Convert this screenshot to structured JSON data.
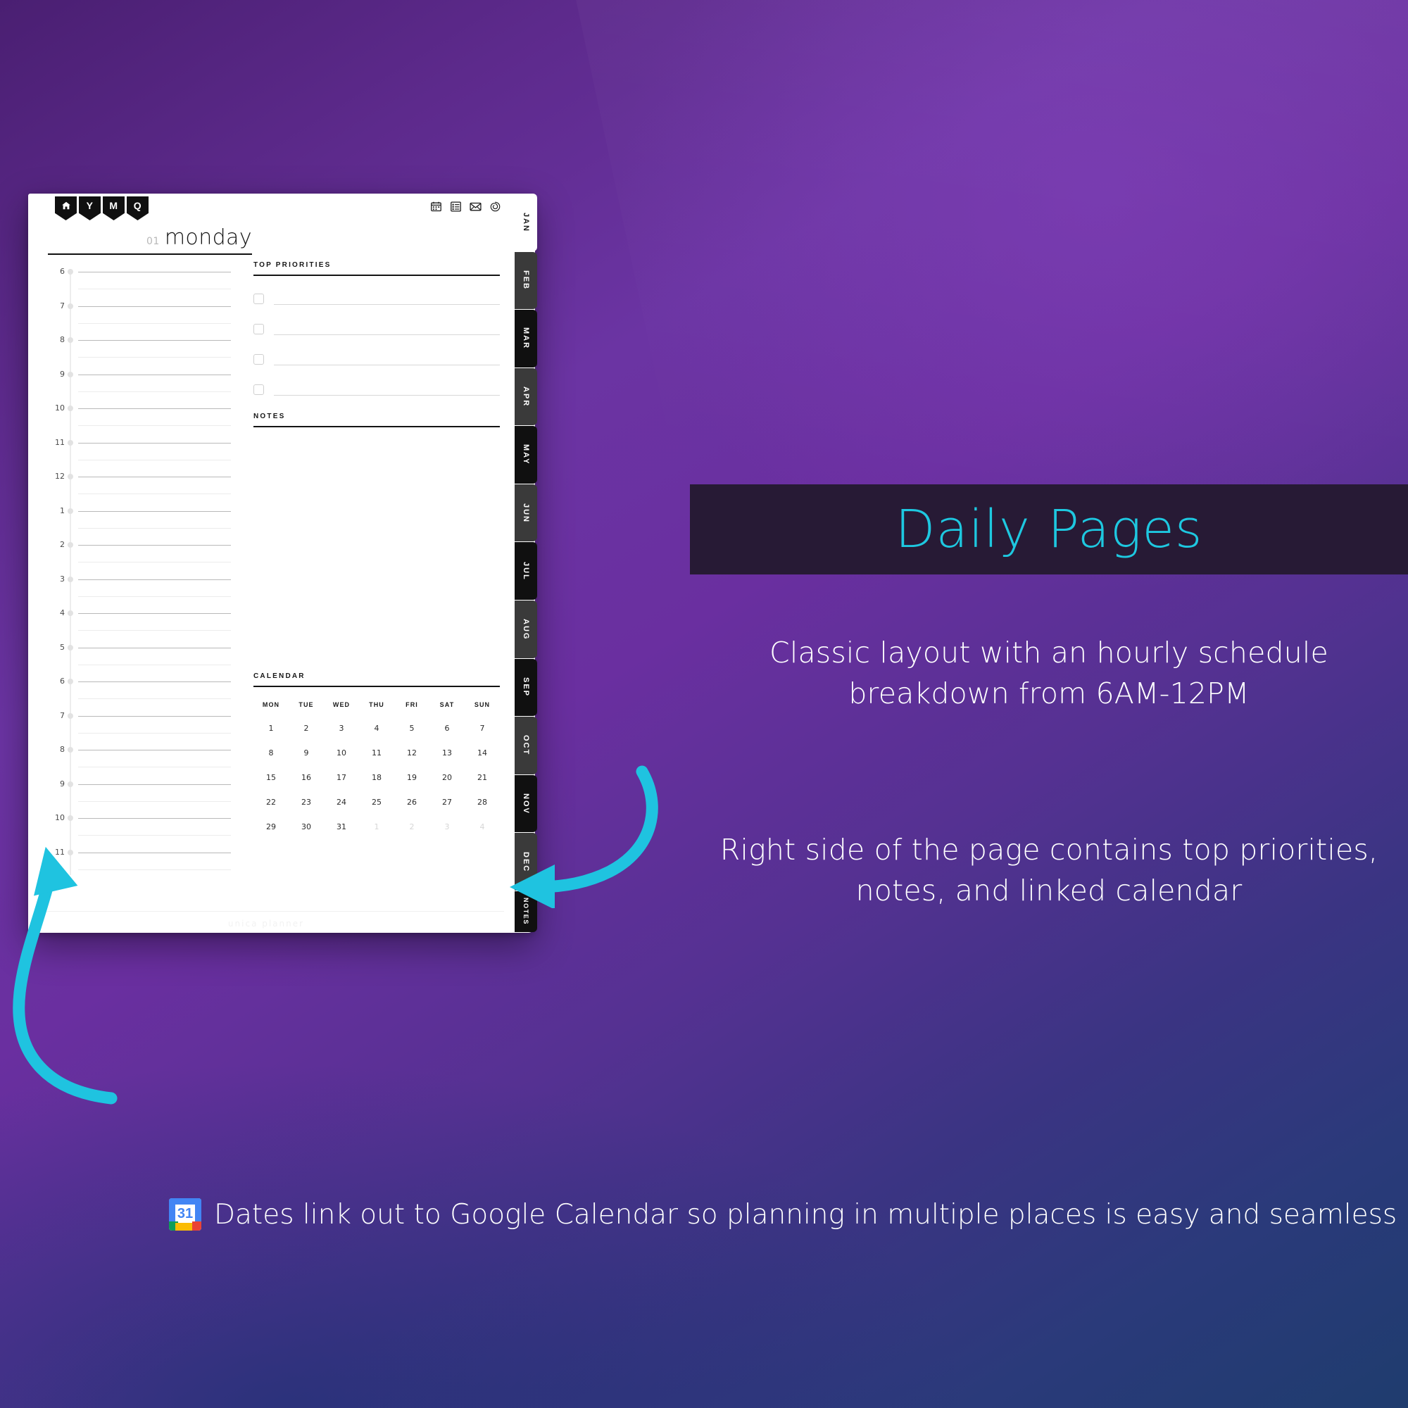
{
  "marketing": {
    "banner_title": "Daily Pages",
    "accent_color": "#1ec8e0",
    "banner_bg": "#271a35",
    "paragraph_1": "Classic layout with an hourly schedule breakdown from 6AM-12PM",
    "paragraph_2": "Right side of the page contains top priorities, notes, and linked calendar",
    "caption": "Dates link out to Google Calendar so planning in multiple places is easy and seamless",
    "gcal_icon_day": "31"
  },
  "planner": {
    "nav_tabs": [
      {
        "label": "",
        "icon": "home-icon"
      },
      {
        "label": "Y",
        "icon": "year-tab"
      },
      {
        "label": "M",
        "icon": "month-tab"
      },
      {
        "label": "Q",
        "icon": "quarter-tab"
      }
    ],
    "toolbar_icons": [
      "calendar-icon",
      "list-icon",
      "mail-icon",
      "spiral-icon"
    ],
    "date_number": "01",
    "day_name": "monday",
    "schedule": {
      "hours": [
        "6",
        "7",
        "8",
        "9",
        "10",
        "11",
        "12",
        "1",
        "2",
        "3",
        "4",
        "5",
        "6",
        "7",
        "8",
        "9",
        "10",
        "11"
      ]
    },
    "sections": {
      "priorities_heading": "TOP PRIORITIES",
      "priorities_count": 4,
      "notes_heading": "NOTES",
      "calendar_heading": "CALENDAR"
    },
    "calendar": {
      "day_names": [
        "MON",
        "TUE",
        "WED",
        "THU",
        "FRI",
        "SAT",
        "SUN"
      ],
      "weeks": [
        [
          {
            "d": "1",
            "m": false
          },
          {
            "d": "2",
            "m": false
          },
          {
            "d": "3",
            "m": false
          },
          {
            "d": "4",
            "m": false
          },
          {
            "d": "5",
            "m": false
          },
          {
            "d": "6",
            "m": false
          },
          {
            "d": "7",
            "m": false
          }
        ],
        [
          {
            "d": "8",
            "m": false
          },
          {
            "d": "9",
            "m": false
          },
          {
            "d": "10",
            "m": false
          },
          {
            "d": "11",
            "m": false
          },
          {
            "d": "12",
            "m": false
          },
          {
            "d": "13",
            "m": false
          },
          {
            "d": "14",
            "m": false
          }
        ],
        [
          {
            "d": "15",
            "m": false
          },
          {
            "d": "16",
            "m": false
          },
          {
            "d": "17",
            "m": false
          },
          {
            "d": "18",
            "m": false
          },
          {
            "d": "19",
            "m": false
          },
          {
            "d": "20",
            "m": false
          },
          {
            "d": "21",
            "m": false
          }
        ],
        [
          {
            "d": "22",
            "m": false
          },
          {
            "d": "23",
            "m": false
          },
          {
            "d": "24",
            "m": false
          },
          {
            "d": "25",
            "m": false
          },
          {
            "d": "26",
            "m": false
          },
          {
            "d": "27",
            "m": false
          },
          {
            "d": "28",
            "m": false
          }
        ],
        [
          {
            "d": "29",
            "m": false
          },
          {
            "d": "30",
            "m": false
          },
          {
            "d": "31",
            "m": false
          },
          {
            "d": "1",
            "m": true
          },
          {
            "d": "2",
            "m": true
          },
          {
            "d": "3",
            "m": true
          },
          {
            "d": "4",
            "m": true
          }
        ]
      ]
    },
    "footer": "unica planner",
    "month_tabs": [
      {
        "label": "JAN",
        "state": "active"
      },
      {
        "label": "FEB",
        "state": "gray"
      },
      {
        "label": "MAR",
        "state": "dark"
      },
      {
        "label": "APR",
        "state": "gray"
      },
      {
        "label": "MAY",
        "state": "dark"
      },
      {
        "label": "JUN",
        "state": "gray"
      },
      {
        "label": "JUL",
        "state": "dark"
      },
      {
        "label": "AUG",
        "state": "gray"
      },
      {
        "label": "SEP",
        "state": "dark"
      },
      {
        "label": "OCT",
        "state": "gray"
      },
      {
        "label": "NOV",
        "state": "dark"
      },
      {
        "label": "DEC",
        "state": "gray"
      },
      {
        "label": "NOTES",
        "state": "notes"
      }
    ]
  }
}
